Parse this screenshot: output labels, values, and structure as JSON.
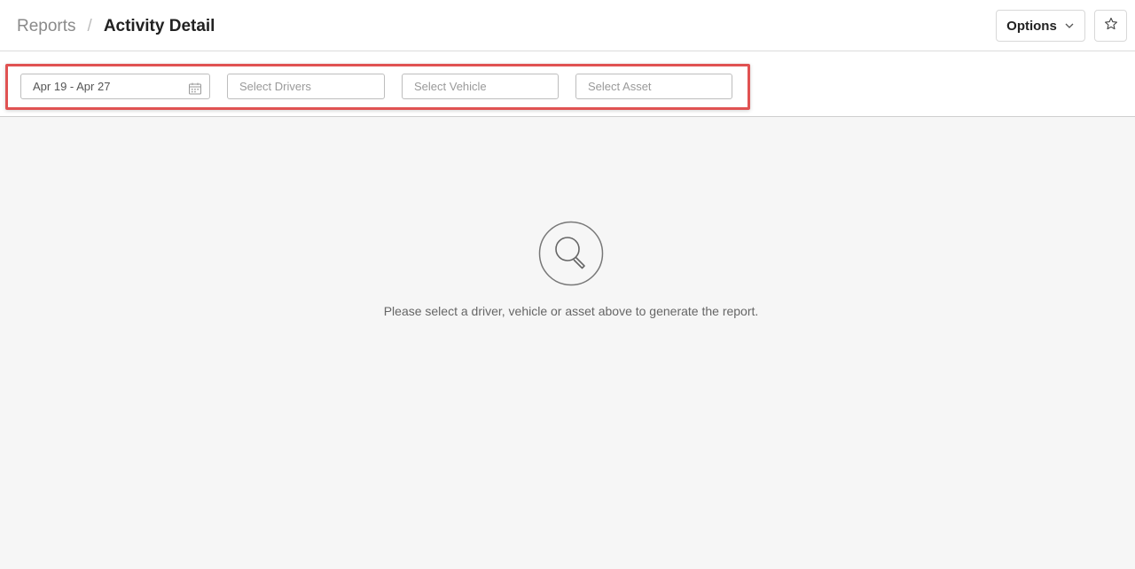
{
  "breadcrumb": {
    "parent": "Reports",
    "separator": "/",
    "current": "Activity Detail"
  },
  "header": {
    "options_label": "Options"
  },
  "filters": {
    "date_range_value": "Apr 19 - Apr 27",
    "drivers_placeholder": "Select Drivers",
    "vehicle_placeholder": "Select Vehicle",
    "asset_placeholder": "Select Asset"
  },
  "empty_state": {
    "message": "Please select a driver, vehicle or asset above to generate the report."
  },
  "colors": {
    "highlight": "#e05252",
    "background": "#f6f6f6"
  },
  "icons": [
    "chevron-down-icon",
    "star-icon",
    "calendar-icon",
    "search-icon"
  ]
}
